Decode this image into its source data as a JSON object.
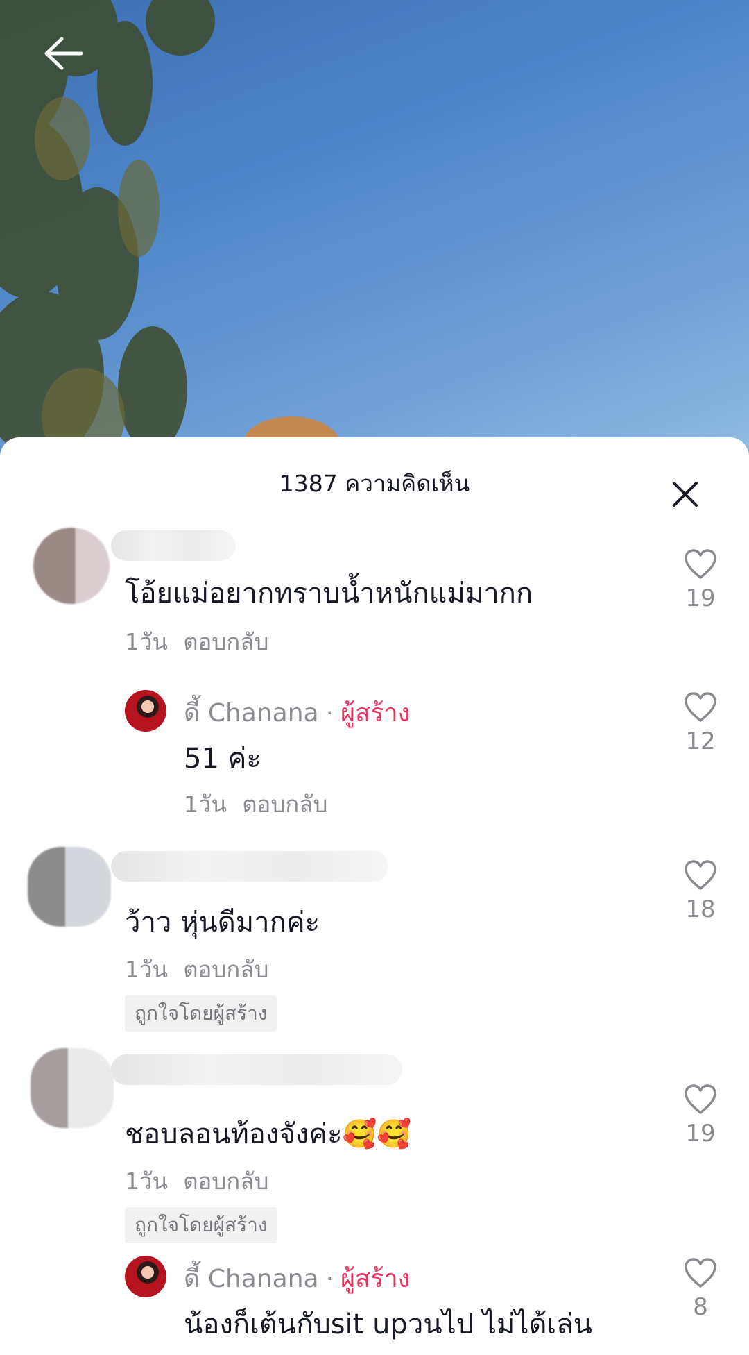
{
  "sheet": {
    "title": "1387 ความคิดเห็น"
  },
  "icons": {
    "back": "arrow-left-icon",
    "close": "close-icon",
    "like": "heart-outline-icon"
  },
  "colors": {
    "creator_tag": "#e8355f",
    "meta_text": "#8a8b91",
    "primary_text": "#161823"
  },
  "comments": [
    {
      "text": "โอ้ยแม่อยากทราบน้ำหนักแม่มากก",
      "time": "1วัน",
      "reply_label": "ตอบกลับ",
      "likes": "19"
    },
    {
      "author": "ดี้ Chanana",
      "separator": "·",
      "creator_label": "ผู้สร้าง",
      "text": "51 ค่ะ",
      "time": "1วัน",
      "reply_label": "ตอบกลับ",
      "likes": "12"
    },
    {
      "text": "ว้าว หุ่นดีมากค่ะ",
      "time": "1วัน",
      "reply_label": "ตอบกลับ",
      "badge": "ถูกใจโดยผู้สร้าง",
      "likes": "18"
    },
    {
      "text": "ชอบลอนท้องจังค่ะ🥰🥰",
      "time": "1วัน",
      "reply_label": "ตอบกลับ",
      "badge": "ถูกใจโดยผู้สร้าง",
      "likes": "19"
    },
    {
      "author": "ดี้ Chanana",
      "separator": "·",
      "creator_label": "ผู้สร้าง",
      "text": "น้องก็เต้นกับsit upวนไป ไม่ได้เล่น",
      "likes": "8"
    }
  ]
}
